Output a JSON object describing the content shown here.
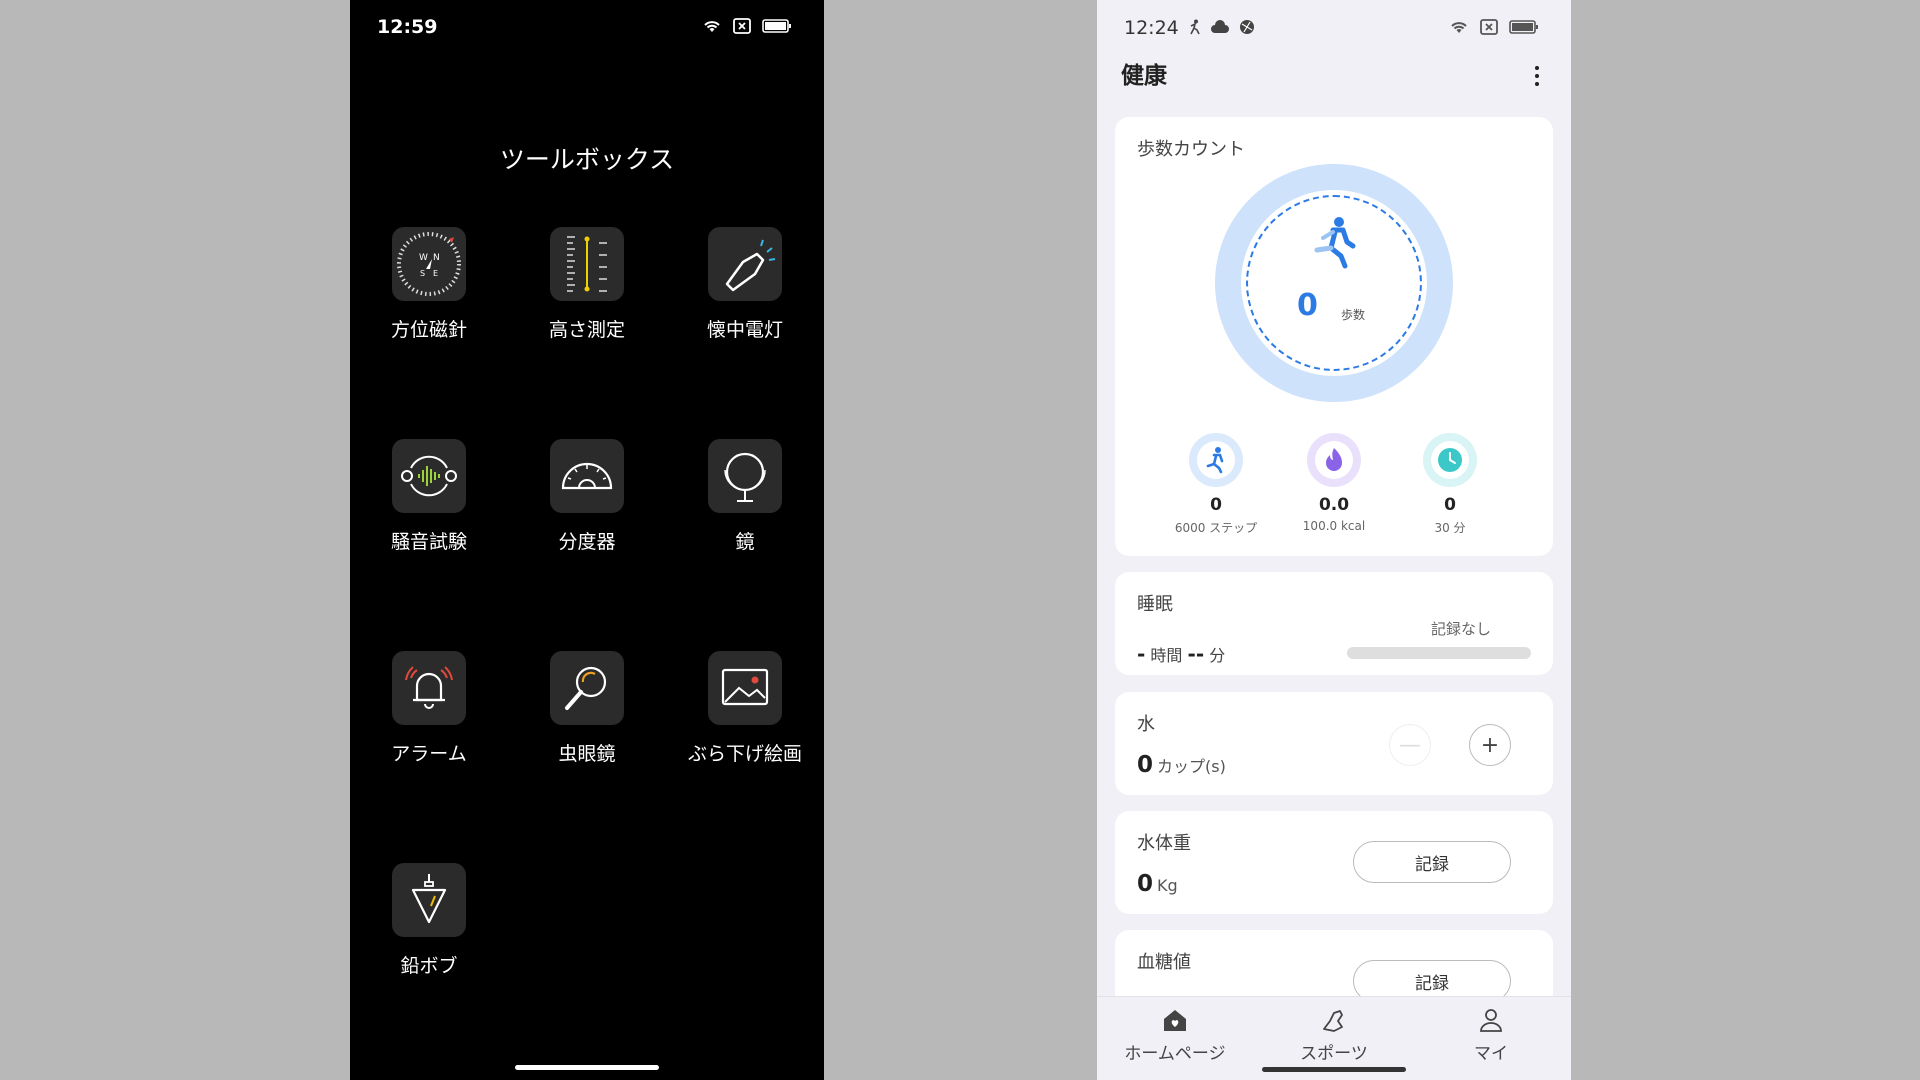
{
  "left_phone": {
    "status": {
      "time": "12:59"
    },
    "title": "ツールボックス",
    "tools": [
      {
        "label": "方位磁針",
        "icon": "compass-icon"
      },
      {
        "label": "高さ測定",
        "icon": "ruler-icon"
      },
      {
        "label": "懐中電灯",
        "icon": "flashlight-icon"
      },
      {
        "label": "騒音試験",
        "icon": "noise-meter-icon"
      },
      {
        "label": "分度器",
        "icon": "protractor-icon"
      },
      {
        "label": "鏡",
        "icon": "mirror-icon"
      },
      {
        "label": "アラーム",
        "icon": "alarm-bell-icon"
      },
      {
        "label": "虫眼鏡",
        "icon": "magnifier-icon"
      },
      {
        "label": "ぶら下げ絵画",
        "icon": "picture-frame-icon"
      },
      {
        "label": "鉛ボブ",
        "icon": "plumb-bob-icon"
      }
    ]
  },
  "right_phone": {
    "status": {
      "time": "12:24"
    },
    "header": {
      "title": "健康"
    },
    "steps": {
      "title": "歩数カウント",
      "count": "0",
      "unit": "歩数",
      "stats": [
        {
          "value": "0",
          "sub": "6000 ステップ",
          "icon": "walk-icon",
          "color": "#2c7be5"
        },
        {
          "value": "0.0",
          "sub": "100.0 kcal",
          "icon": "flame-icon",
          "color": "#8a63e8"
        },
        {
          "value": "0",
          "sub": "30 分",
          "icon": "clock-icon",
          "color": "#3cc8c8"
        }
      ]
    },
    "sleep": {
      "title": "睡眠",
      "hours": "-",
      "hours_unit": "時間",
      "minutes": "--",
      "minutes_unit": "分",
      "status": "記録なし"
    },
    "water": {
      "title": "水",
      "value": "0",
      "unit": "カップ(s)",
      "minus": "—",
      "plus": "+"
    },
    "weight": {
      "title": "水体重",
      "value": "0",
      "unit": "Kg",
      "button": "記録"
    },
    "glucose": {
      "title": "血糖値",
      "button": "記録"
    },
    "nav": [
      {
        "label": "ホームページ",
        "icon": "home-icon"
      },
      {
        "label": "スポーツ",
        "icon": "shoe-icon"
      },
      {
        "label": "マイ",
        "icon": "person-icon"
      }
    ]
  }
}
